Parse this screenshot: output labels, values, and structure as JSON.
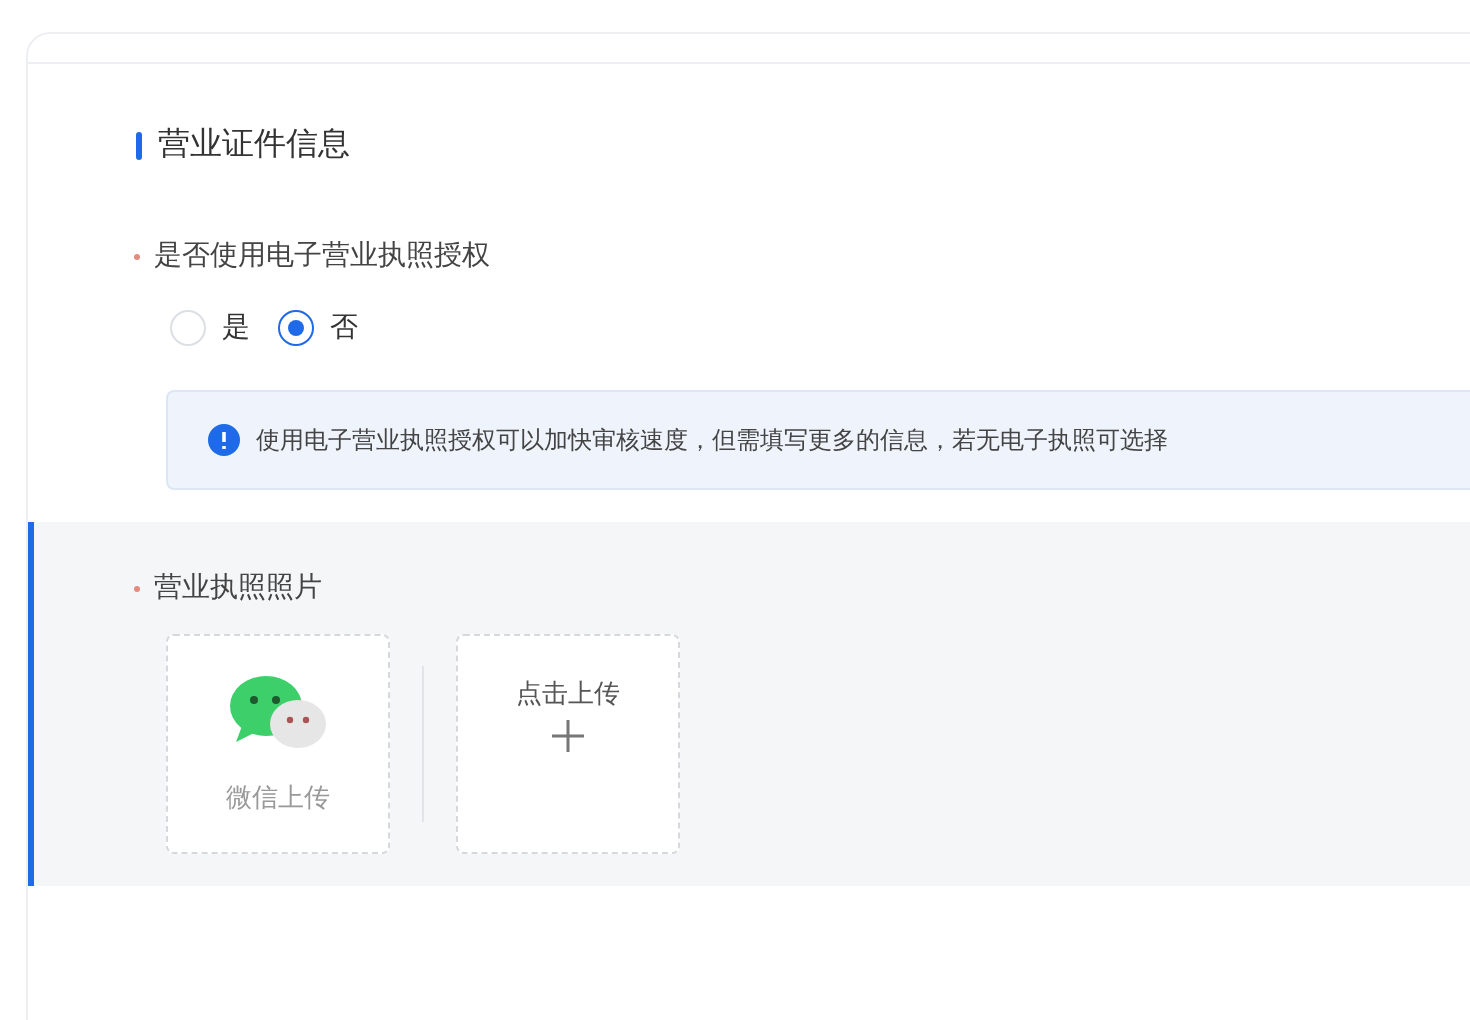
{
  "section": {
    "title": "营业证件信息"
  },
  "license_auth": {
    "label": "是否使用电子营业执照授权",
    "required": true,
    "options": [
      {
        "label": "是",
        "selected": false
      },
      {
        "label": "否",
        "selected": true
      }
    ],
    "notice": "使用电子营业执照授权可以加快审核速度，但需填写更多的信息，若无电子执照可选择"
  },
  "license_photo": {
    "label": "营业执照照片",
    "required": true,
    "highlighted": true,
    "uploads": [
      {
        "kind": "wechat",
        "label": "微信上传"
      },
      {
        "kind": "click",
        "label": "点击上传"
      }
    ]
  }
}
